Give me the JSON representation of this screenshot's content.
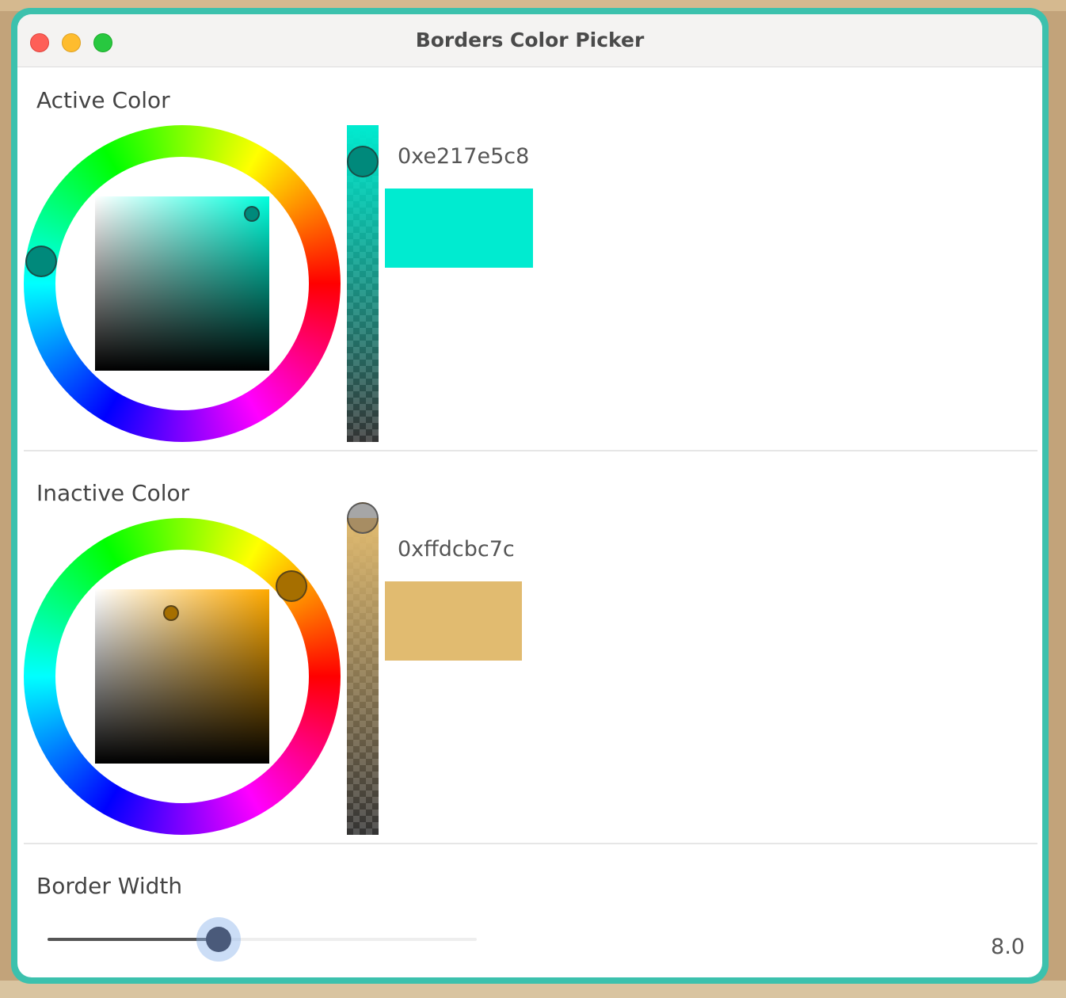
{
  "window": {
    "title": "Borders Color Picker"
  },
  "active": {
    "label": "Active Color",
    "hex": "0xe217e5c8",
    "color": "#00ebd0",
    "handle_color": "#00897b",
    "hue_deg": 172,
    "saturation": 1.0,
    "brightness": 0.9,
    "alpha": 0.89
  },
  "inactive": {
    "label": "Inactive Color",
    "hex": "0xffdcbc7c",
    "color": "#e1bb70",
    "handle_color": "#a66f00",
    "hue_deg": 40,
    "saturation": 0.44,
    "brightness": 0.86,
    "alpha": 1.0
  },
  "border_width": {
    "label": "Border Width",
    "value": "8.0",
    "fraction": 0.4
  },
  "colors": {
    "window_border": "#3cc1ad"
  }
}
